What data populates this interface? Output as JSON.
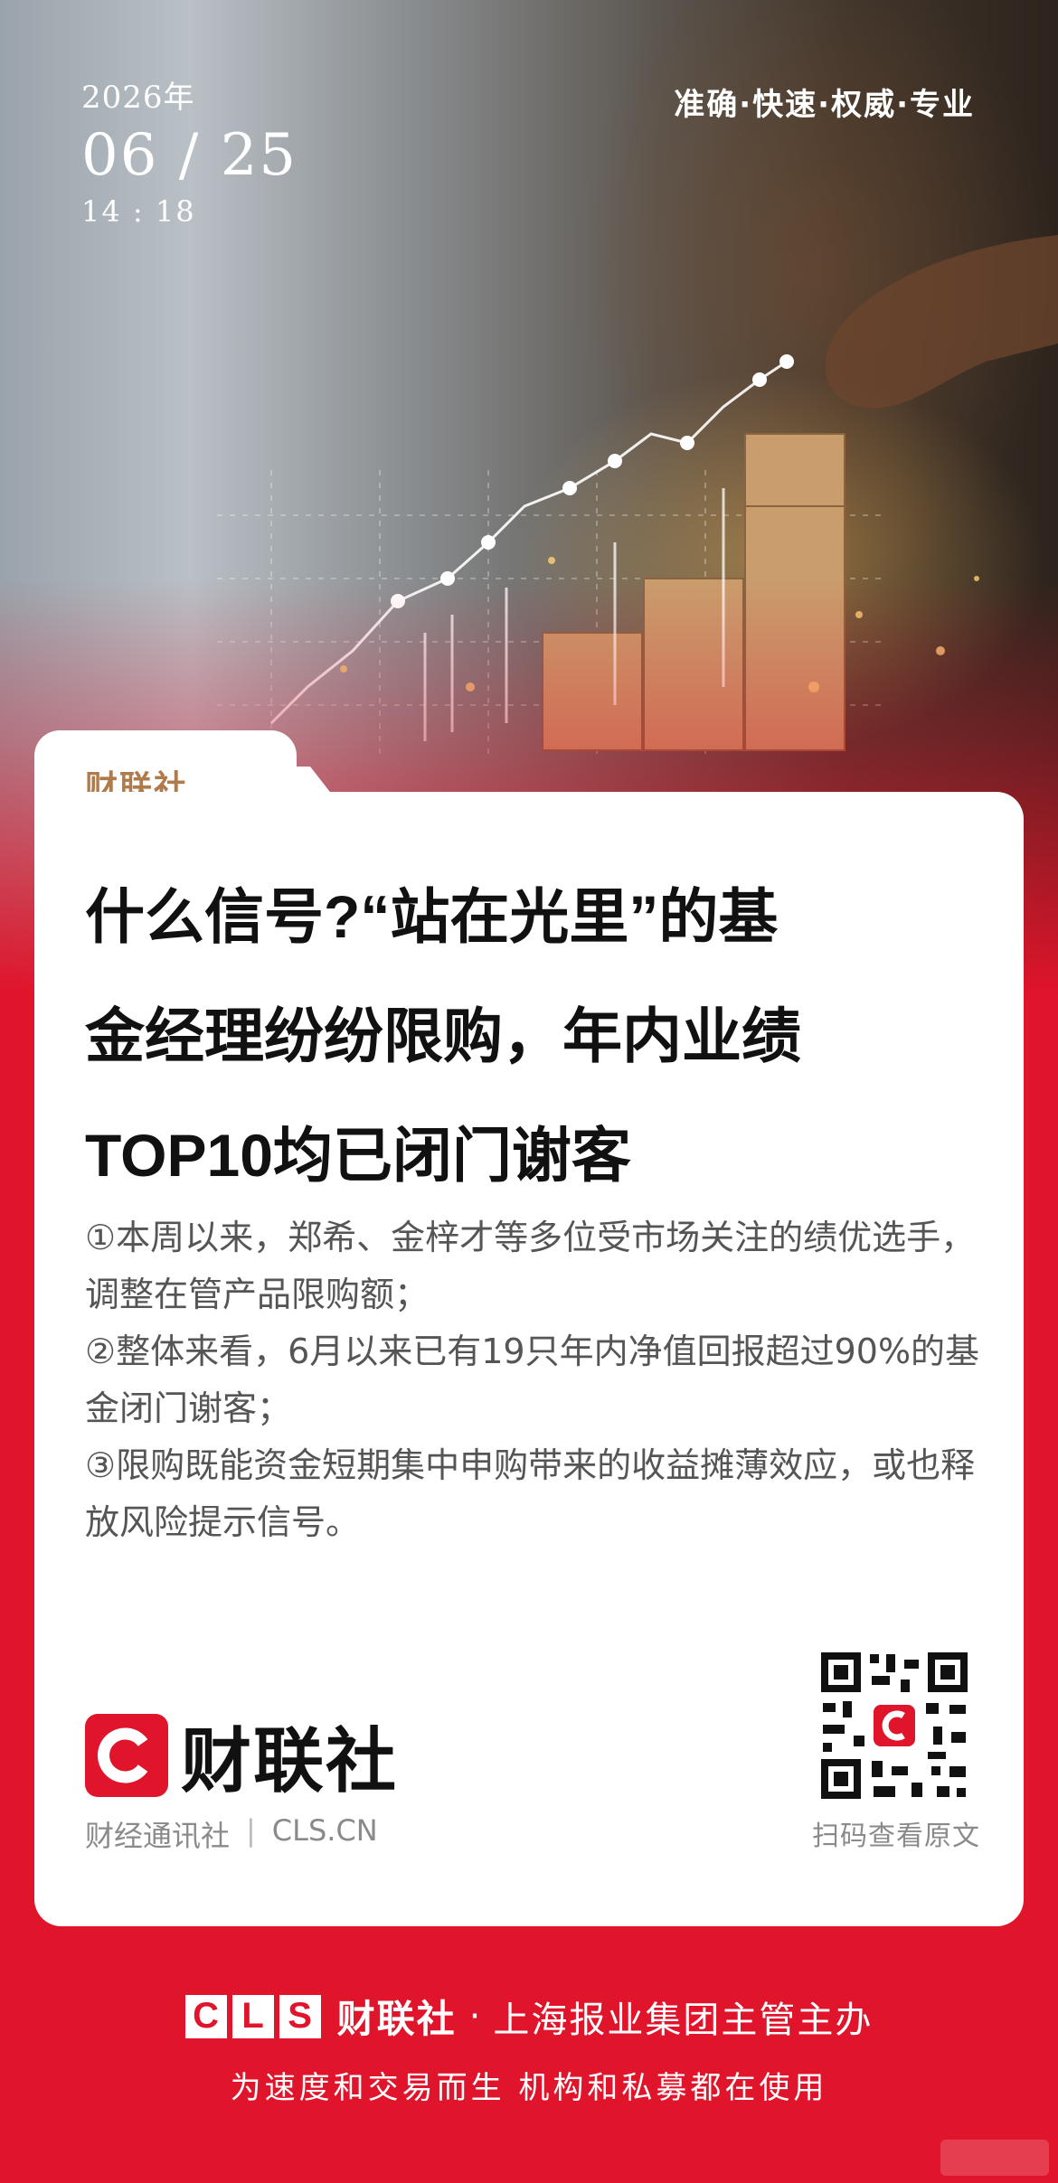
{
  "date": {
    "year": "2026年",
    "month_day": "06 / 25",
    "time": "14 : 18"
  },
  "slogan": "准确·快速·权威·专业",
  "card": {
    "tab_label": "财联社",
    "headline_lines": [
      "什么信号?“站在光里”的基",
      "金经理纷纷限购，年内业绩",
      "TOP10均已闭门谢客"
    ],
    "summary": [
      "①本周以来，郑希、金梓才等多位受市场关注的绩优选手，调整在管产品限购额；",
      "②整体来看，6月以来已有19只年内净值回报超过90%的基金闭门谢客；",
      "③限购既能资金短期集中申购带来的收益摊薄效应，或也释放风险提示信号。"
    ],
    "brand_name": "财联社",
    "brand_sub_left": "财经通讯社",
    "brand_sub_sep": "|",
    "brand_sub_right": "CLS.CN",
    "qr_caption": "扫码查看原文"
  },
  "footer": {
    "cls_letters": [
      "C",
      "L",
      "S"
    ],
    "brand": "财联社",
    "dot": "·",
    "org": "上海报业集团主管主办",
    "tagline": "为速度和交易而生  机构和私募都在使用"
  },
  "colors": {
    "brand_red": "#e0142a",
    "tab_gold": "#b07a4a"
  }
}
